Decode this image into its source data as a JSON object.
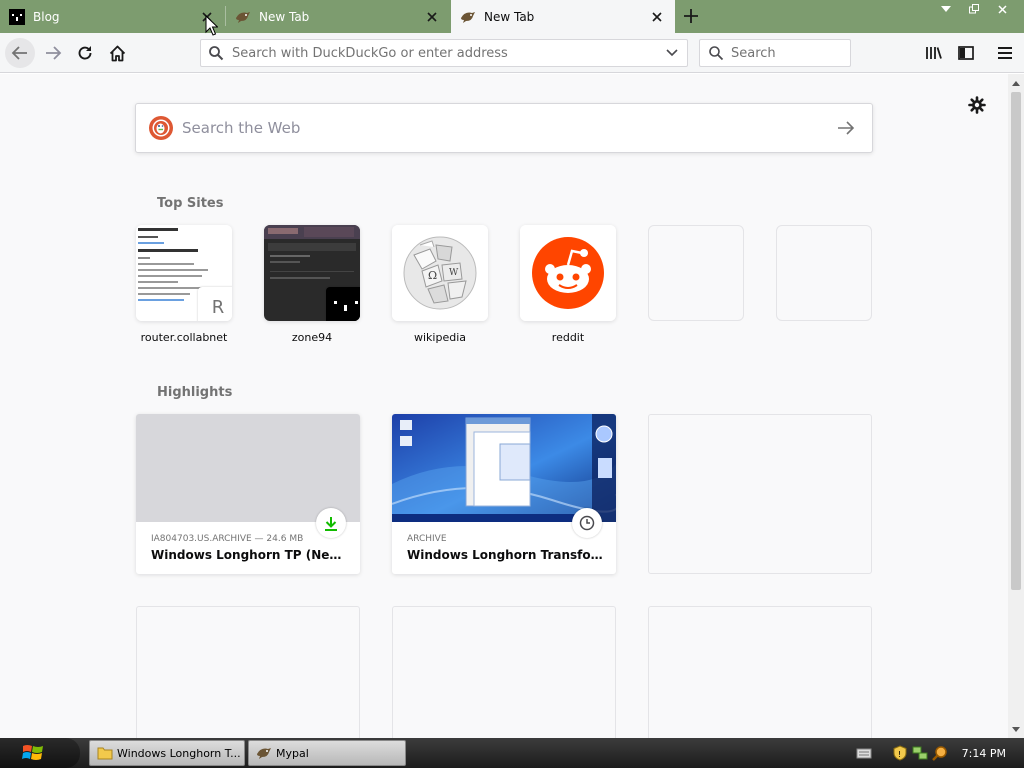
{
  "tabs": [
    {
      "title": "Blog",
      "icon": "blog-favicon",
      "active": false
    },
    {
      "title": "New Tab",
      "icon": "mypal-favicon",
      "active": false
    },
    {
      "title": "New Tab",
      "icon": "mypal-favicon",
      "active": true
    }
  ],
  "navbar": {
    "url_placeholder": "Search with DuckDuckGo or enter address",
    "search_placeholder": "Search"
  },
  "newtab": {
    "web_search_placeholder": "Search the Web",
    "top_sites_title": "Top Sites",
    "top_sites": [
      {
        "label": "router.collabnet",
        "badge": "R"
      },
      {
        "label": "zone94"
      },
      {
        "label": "wikipedia"
      },
      {
        "label": "reddit"
      },
      {
        "label": ""
      },
      {
        "label": ""
      }
    ],
    "highlights_title": "Highlights",
    "highlights": [
      {
        "context": "IA804703.US.ARCHIVE — 24.6 MB",
        "title": "Windows Longhorn TP (New).zip",
        "type_icon": "download-icon"
      },
      {
        "context": "ARCHIVE",
        "title": "Windows Longhorn Transformat...",
        "type_icon": "history-icon"
      }
    ]
  },
  "taskbar": {
    "tasks": [
      {
        "label": "Windows Longhorn T...",
        "icon": "folder-icon"
      },
      {
        "label": "Mypal",
        "icon": "mypal-icon"
      }
    ],
    "clock": "7:14 PM"
  },
  "colors": {
    "tabstrip": "#7d9c6f",
    "toolbar": "#f5f6f7",
    "content_bg": "#f9f9fa",
    "reddit": "#ff4500",
    "download_green": "#12bc00"
  }
}
